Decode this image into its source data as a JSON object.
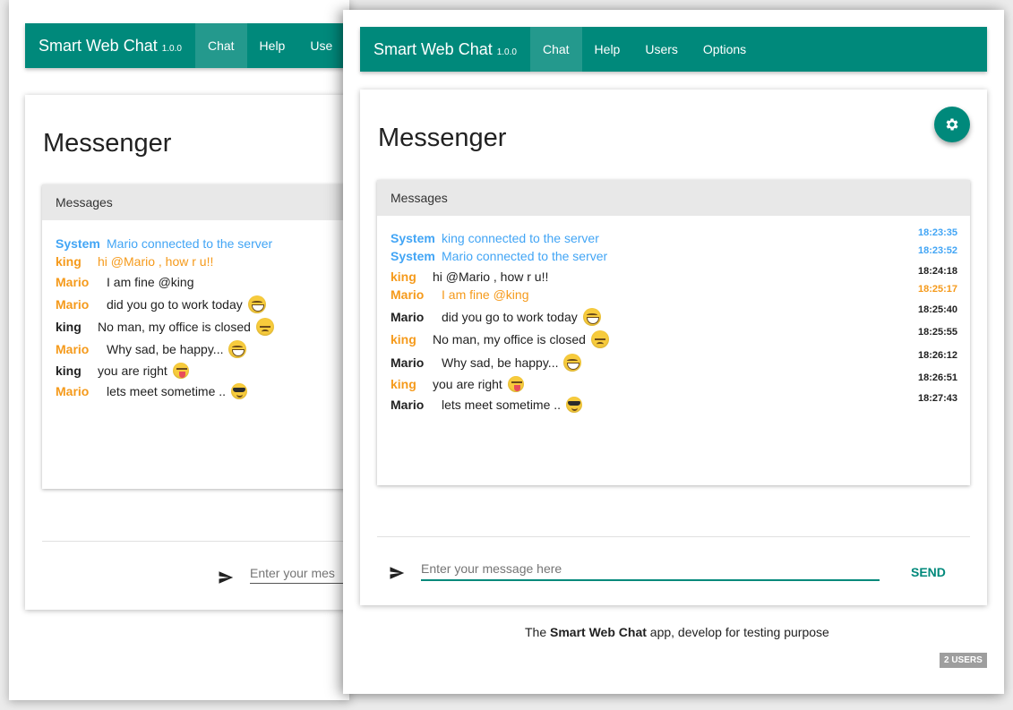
{
  "app": {
    "name": "Smart Web Chat",
    "version": "1.0.0"
  },
  "nav": {
    "items": [
      "Chat",
      "Help",
      "Users",
      "Options"
    ],
    "back_cut_label": "Use"
  },
  "page_title": "Messenger",
  "messages_panel": {
    "title": "Messages"
  },
  "back_messages": [
    {
      "user": "System",
      "text": "Mario connected to the server",
      "style": "sys"
    },
    {
      "user": "king",
      "text": "hi @Mario , how r u!!",
      "style": "org"
    },
    {
      "user": "Mario",
      "text": "I am fine @king",
      "style": "org-user"
    },
    {
      "user": "Mario",
      "text": "did you go to work today",
      "style": "org-user",
      "emoji": "grinning-face"
    },
    {
      "user": "king",
      "text": "No man, my office is closed",
      "style": "blk",
      "emoji": "pensive-face"
    },
    {
      "user": "Mario",
      "text": "Why sad, be happy...",
      "style": "org-user",
      "emoji": "grinning-face"
    },
    {
      "user": "king",
      "text": "you are right",
      "style": "blk",
      "emoji": "tongue-face"
    },
    {
      "user": "Mario",
      "text": "lets meet sometime ..",
      "style": "org-user",
      "emoji": "sunglasses-face"
    }
  ],
  "front_messages": [
    {
      "user": "System",
      "text": "king connected to the server",
      "time": "18:23:35",
      "style": "sys"
    },
    {
      "user": "System",
      "text": "Mario connected to the server",
      "time": "18:23:52",
      "style": "sys"
    },
    {
      "user": "king",
      "text": "hi @Mario , how r u!!",
      "time": "18:24:18",
      "style": "org-user"
    },
    {
      "user": "Mario",
      "text": "I am fine @king",
      "time": "18:25:17",
      "style": "org"
    },
    {
      "user": "Mario",
      "text": "did you go to work today",
      "time": "18:25:40",
      "style": "blk",
      "emoji": "grinning-face"
    },
    {
      "user": "king",
      "text": "No man, my office is closed",
      "time": "18:25:55",
      "style": "org-user",
      "emoji": "pensive-face"
    },
    {
      "user": "Mario",
      "text": "Why sad, be happy...",
      "time": "18:26:12",
      "style": "blk",
      "emoji": "grinning-face"
    },
    {
      "user": "king",
      "text": "you are right",
      "time": "18:26:51",
      "style": "org-user",
      "emoji": "tongue-face"
    },
    {
      "user": "Mario",
      "text": "lets meet sometime ..",
      "time": "18:27:43",
      "style": "blk",
      "emoji": "sunglasses-face"
    }
  ],
  "input": {
    "placeholder": "Enter your message here",
    "back_visible_placeholder": "Enter your mes",
    "value": ""
  },
  "send_label": "SEND",
  "footer": {
    "prefix": "The ",
    "app_name": "Smart Web Chat",
    "suffix": " app, develop for testing purpose"
  },
  "users_badge": "2 USERS",
  "colors": {
    "primary": "#00897b",
    "system": "#42a5f5",
    "highlight": "#f59a1b"
  },
  "icons": {
    "settings": "gear-icon",
    "send": "send-icon"
  }
}
